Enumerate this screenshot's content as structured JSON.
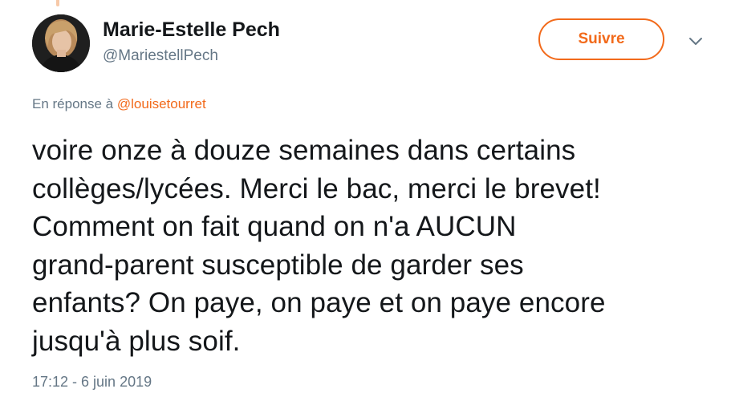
{
  "author": {
    "name": "Marie-Estelle Pech",
    "handle": "@MariestellPech"
  },
  "follow_button": {
    "label": "Suivre"
  },
  "menu": {
    "icon": "chevron-down-icon"
  },
  "reply": {
    "prefix": "En réponse à",
    "mention": "@louisetourret"
  },
  "tweet": {
    "lines": [
      "voire onze à douze semaines dans certains",
      "collèges/lycées. Merci le bac, merci le brevet!",
      "Comment on fait quand on n'a AUCUN",
      "grand-parent susceptible de garder ses",
      "enfants? On paye, on paye et on paye encore",
      "jusqu'à plus soif."
    ]
  },
  "timestamp": "17:12 - 6 juin 2019",
  "colors": {
    "accent": "#f26a1b",
    "text": "#14171a",
    "secondary": "#657786"
  }
}
